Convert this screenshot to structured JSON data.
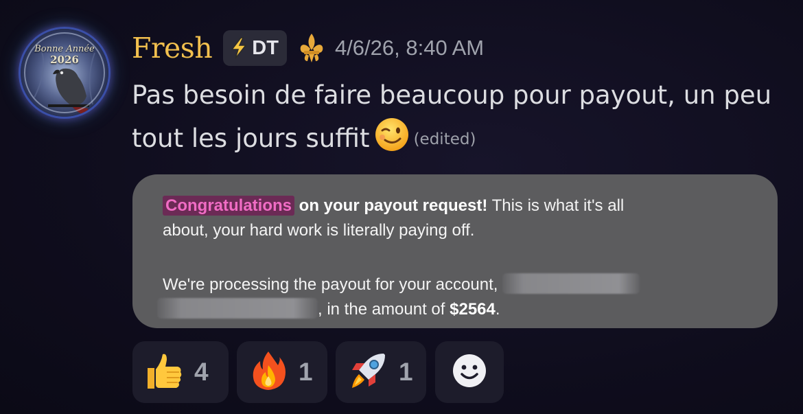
{
  "message": {
    "username": "Fresh",
    "tag_label": "DT",
    "timestamp": "4/6/26, 8:40 AM",
    "content_text": "Pas besoin de faire beaucoup pour payout, un peu tout les jours suffit",
    "edited_label": "(edited)",
    "avatar": {
      "caption_line1": "Bonne Année",
      "caption_line2": "2026"
    }
  },
  "embed": {
    "highlight": "Congratulations",
    "bold_1": "on your payout request!",
    "text_1": " This is what it's all",
    "text_2": "about, your hard work is literally paying off.",
    "text_3": "We're processing the payout for your account,",
    "text_4": ", in the amount of ",
    "amount": "$2564",
    "period": "."
  },
  "reactions": [
    {
      "emoji": "thumbs-up",
      "count": "4"
    },
    {
      "emoji": "fire",
      "count": "1"
    },
    {
      "emoji": "rocket",
      "count": "1"
    }
  ],
  "colors": {
    "username": "#f2c04e",
    "embed_bg": "#5c5c5e",
    "highlight_bg": "#6b2a55",
    "highlight_fg": "#f06cc4"
  }
}
